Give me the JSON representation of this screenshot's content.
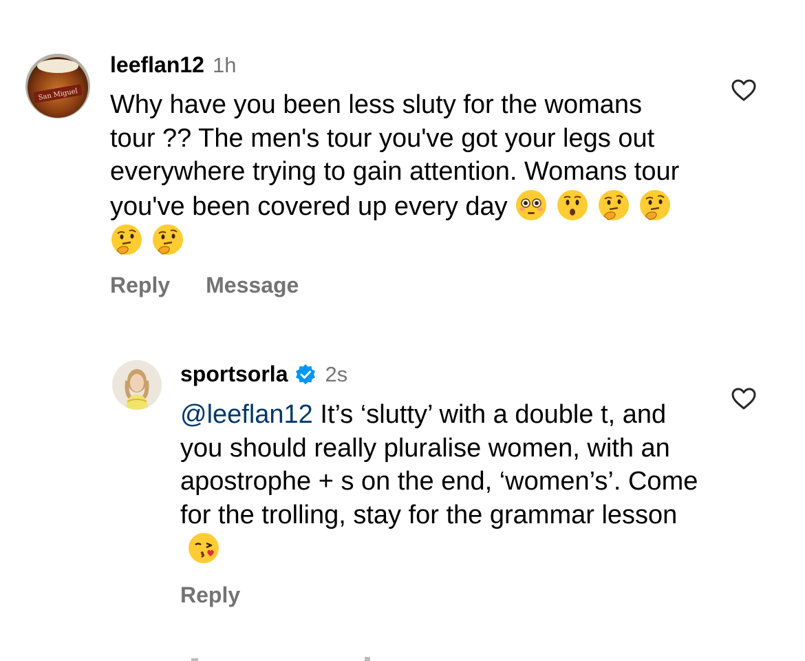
{
  "comments": [
    {
      "username": "leeflan12",
      "time": "1h",
      "text_before_emoji": "Why have you been less sluty for the womans tour ?? The men's tour you've got your legs out everywhere trying to gain attention.  Womans tour you've been covered up every day",
      "emojis": [
        "flushed-face-emoji",
        "hushed-face-emoji",
        "thinking-face-emoji",
        "thinking-face-emoji",
        "thinking-face-emoji",
        "thinking-face-emoji"
      ],
      "avatar_label": "San Miguel",
      "actions": [
        "Reply",
        "Message"
      ]
    },
    {
      "username": "sportsorla",
      "verified": true,
      "time": "2s",
      "mention": "@leeflan12",
      "text": " It’s ‘slutty’ with a double t, and you should really pluralise women, with an apostrophe + s on the end, ‘women’s’.  Come for the trolling, stay for the grammar lesson",
      "emojis": [
        "face-blowing-a-kiss-emoji"
      ],
      "actions": [
        "Reply"
      ]
    }
  ],
  "colors": {
    "secondary_text": "#737373",
    "mention": "#00376b",
    "verified_badge": "#0095f6"
  }
}
